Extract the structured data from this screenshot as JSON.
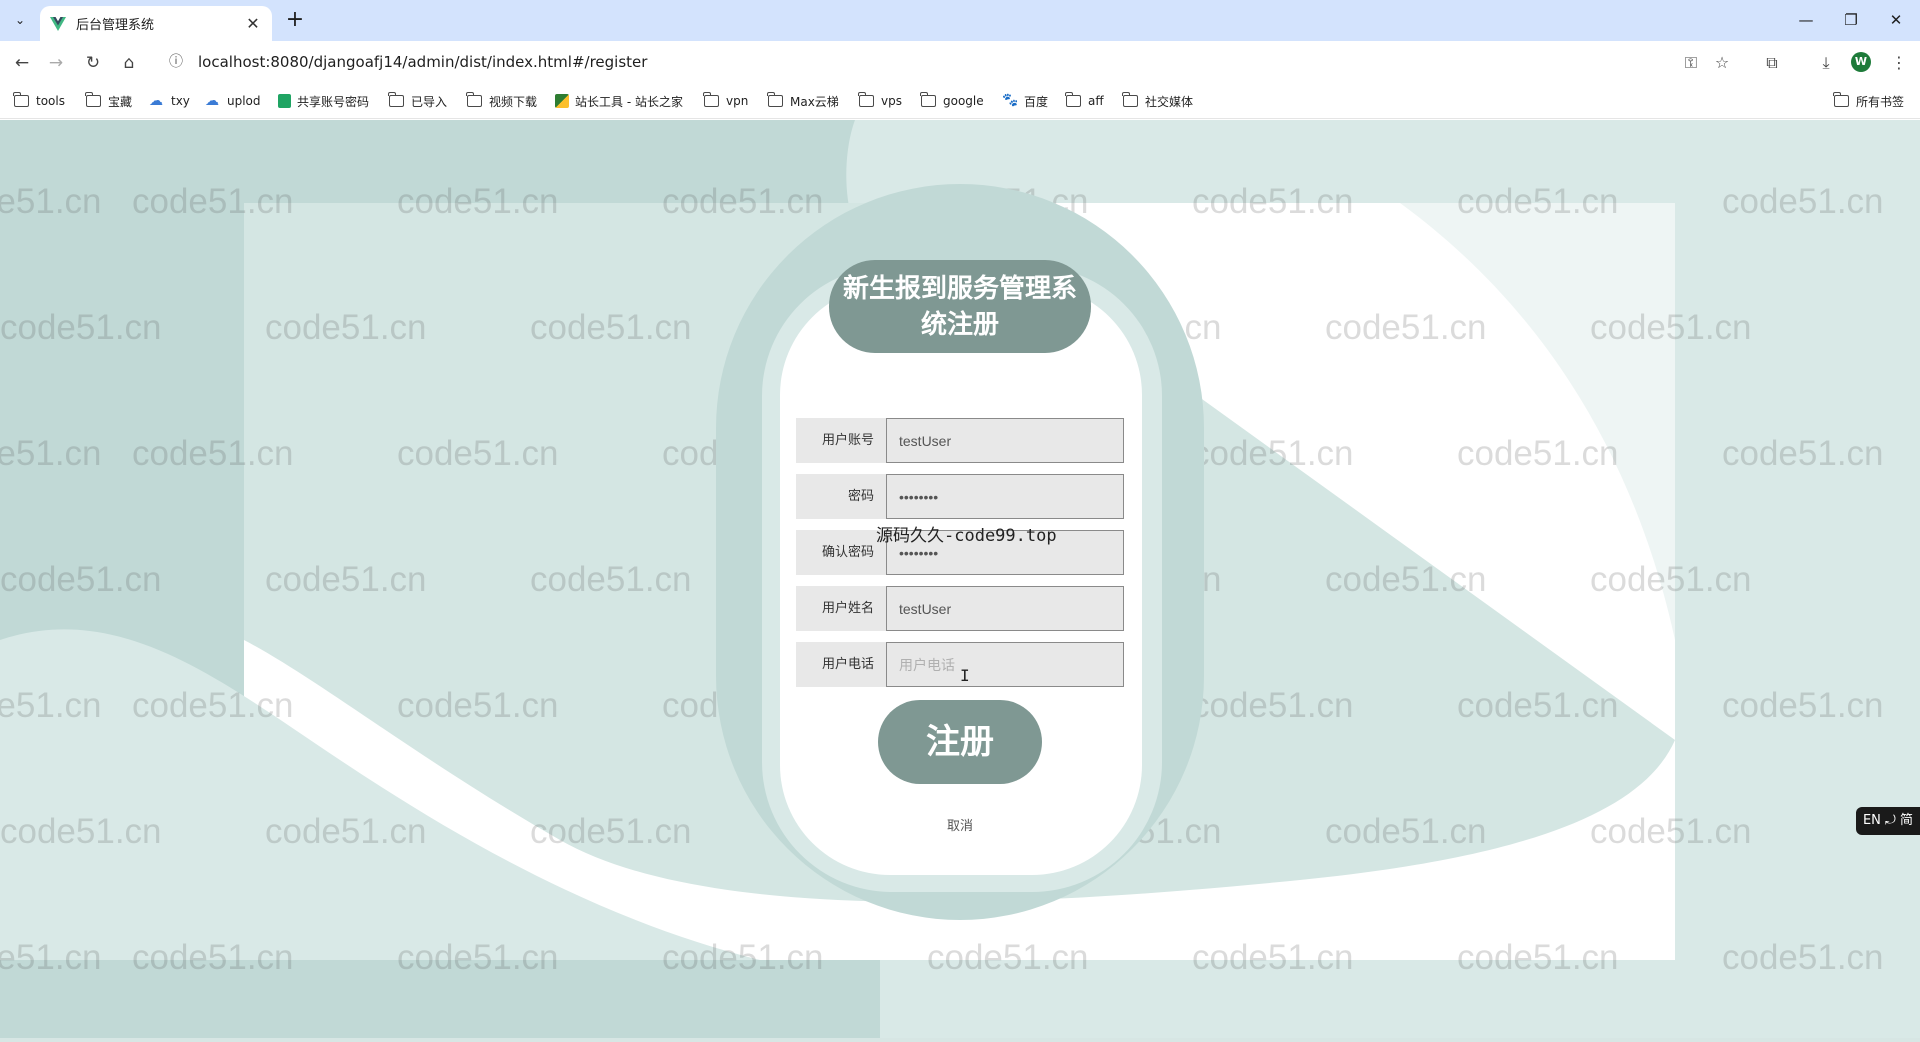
{
  "browser": {
    "tab_title": "后台管理系统",
    "url": "localhost:8080/djangoafj14/admin/dist/index.html#/register",
    "profile_initial": "W",
    "bookmarks": [
      {
        "label": "tools",
        "icon": "folder-icon"
      },
      {
        "label": "宝藏",
        "icon": "folder-icon"
      },
      {
        "label": "txy",
        "icon": "cloud-icon"
      },
      {
        "label": "uplod",
        "icon": "cloud-icon"
      },
      {
        "label": "共享账号密码",
        "icon": "sheet-icon"
      },
      {
        "label": "已导入",
        "icon": "folder-icon"
      },
      {
        "label": "视频下载",
        "icon": "folder-icon"
      },
      {
        "label": "站长工具 - 站长之家",
        "icon": "site-icon"
      },
      {
        "label": "vpn",
        "icon": "folder-icon"
      },
      {
        "label": "Max云梯",
        "icon": "folder-icon"
      },
      {
        "label": "vps",
        "icon": "folder-icon"
      },
      {
        "label": "google",
        "icon": "folder-icon"
      },
      {
        "label": "百度",
        "icon": "baidu-icon"
      },
      {
        "label": "aff",
        "icon": "folder-icon"
      },
      {
        "label": "社交媒体",
        "icon": "folder-icon"
      }
    ],
    "all_bookmarks": "所有书签"
  },
  "page": {
    "title": "新生报到服务管理系统注册",
    "fields": [
      {
        "label": "用户账号",
        "value": "testUser",
        "placeholder": "用户账号",
        "type": "text"
      },
      {
        "label": "密码",
        "value": "••••••••",
        "placeholder": "密码",
        "type": "text"
      },
      {
        "label": "确认密码",
        "value": "••••••••",
        "placeholder": "确认密码",
        "type": "text"
      },
      {
        "label": "用户姓名",
        "value": "testUser",
        "placeholder": "用户姓名",
        "type": "text"
      },
      {
        "label": "用户电话",
        "value": "",
        "placeholder": "用户电话",
        "type": "text"
      }
    ],
    "register_button": "注册",
    "cancel_link": "取消",
    "overlay_text": "源码久久-code99.top",
    "watermark": "code51.cn",
    "ime_badge": "EN ⤾ 简",
    "colors": {
      "page_bg": "#d9e9e7",
      "capsule": "#c1d9d6",
      "accent": "#7f9893"
    }
  }
}
